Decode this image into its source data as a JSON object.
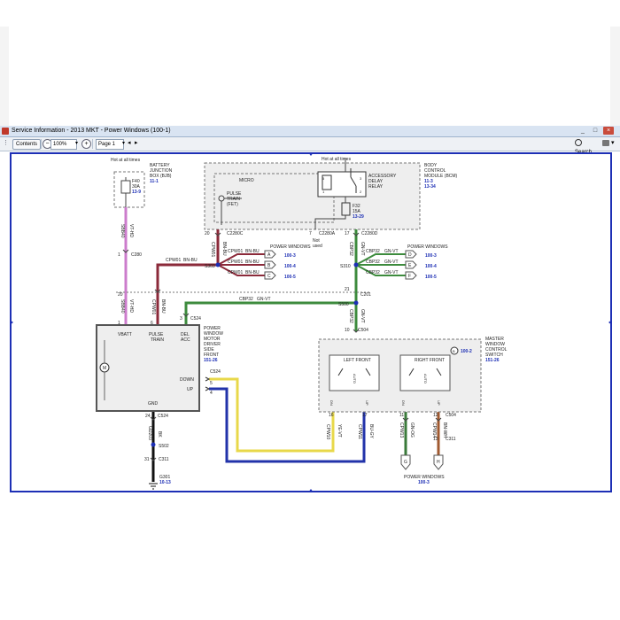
{
  "window": {
    "title": "Service Information - 2013 MKT - Power Windows (100-1)",
    "minimize": "_",
    "maximize": "□",
    "close": "×"
  },
  "toolbar": {
    "contents_label": "Contents",
    "zoom_value": "100%",
    "page_value": "Page 1",
    "search_label": "Search",
    "page_of": "▾"
  },
  "diagram": {
    "hot_at_all_times_left": "Hot at all times",
    "hot_at_all_times_right": "Hot at all times",
    "bjb_title": [
      "BATTERY",
      "JUNCTION",
      "BOX (BJB)"
    ],
    "bjb_ref": "11-1",
    "fuse_left": [
      "F40",
      "30A",
      "13-9"
    ],
    "bcm_title": [
      "BODY",
      "CONTROL",
      "MODULE (BCM)"
    ],
    "bcm_ref": [
      "11-3",
      "13-34"
    ],
    "micro": "MICRO",
    "pulse_train_fet": [
      "PULSE",
      "TRAIN",
      "(FET)"
    ],
    "acc_delay_relay": [
      "ACCESSORY",
      "DELAY",
      "RELAY"
    ],
    "fuse_right": [
      "F32",
      "15A",
      "13-29"
    ],
    "not_used": [
      "Not",
      "used"
    ],
    "connectors": {
      "c2280c": "C2280C",
      "c2280a": "C2280A",
      "c2280d": "C2280D",
      "c280": "C280",
      "s303": "S303",
      "s310": "S310",
      "c201": "C201",
      "s500": "S500",
      "c524a": "C524",
      "c504a": "C504",
      "c524b": "C524",
      "c524c": "C524",
      "s502": "S502",
      "c311a": "C311",
      "g301": "G301",
      "g301_ref": "10-13",
      "c504b": "C504",
      "c311b": "C311"
    },
    "pins": {
      "p20a": "20",
      "p7": "7",
      "p17": "17",
      "p1": "1",
      "p20b": "20",
      "p21": "21",
      "p3": "3",
      "p6": "6",
      "p10": "10",
      "p5": "5",
      "p4": "4",
      "p24": "24",
      "p31": "31",
      "p16": "16",
      "p17b": "17",
      "p11": "11",
      "p12": "12",
      "p13": "13",
      "p5b": "5",
      "p1b": "1",
      "p2": "2",
      "p3b": "3",
      "p4b": "4"
    },
    "wires": {
      "sbb40": "SBB40",
      "vthd": "VT-HD",
      "cpw01_v": "CPW01",
      "bnbu_v": "BN-BU",
      "cpw01_h": "CPW01",
      "bnbu_h": "BN-BU",
      "cpw01_a": "CPW01",
      "bnbu_a": "BN-BU",
      "cpw01_b": "CPW01",
      "bnbu_b": "BN-BU",
      "cpw01_c": "CPW01",
      "bnbu_c": "BN-BU",
      "cbp32_v": "CBP32",
      "gnvt_v": "GN-VT",
      "cbp32_d": "CBP32",
      "gnvt_d": "GN-VT",
      "cbp32_e": "CBP32",
      "gnvt_e": "GN-VT",
      "cbp32_f": "CBP32",
      "gnvt_f": "GN-VT",
      "cbp32_h": "CBP32",
      "gnvt_h": "GN-VT",
      "cbp32_v2": "CBP32",
      "gnvt_v2": "GN-VT",
      "sbb40b": "SBB40",
      "vthd_b": "VT-HD",
      "cpw01_d": "CPW01",
      "bnbu_d": "BN-BU",
      "gd203": "GD203",
      "bk": "BK",
      "cpw10": "CPW10",
      "yevt": "YE-VT",
      "cpw11": "CPW11",
      "bugy": "BU-GY",
      "cpw13": "CPW13",
      "gnog": "GN-OG",
      "cpw14": "CPW14",
      "bnwh": "BN-WH"
    },
    "power_windows_top": "POWER WINDOWS",
    "power_windows_right": "POWER WINDOWS",
    "power_windows_bottom": "POWER WINDOWS",
    "pw_bottom_ref": "100-3",
    "refs_top": [
      "100-3",
      "100-4",
      "100-5"
    ],
    "refs_right": [
      "100-3",
      "100-4",
      "100-5"
    ],
    "letters_top": [
      "A",
      "B",
      "C"
    ],
    "letters_right": [
      "D",
      "E",
      "F"
    ],
    "letters_bottom": [
      "G",
      "H"
    ],
    "motor_title": [
      "POWER",
      "WINDOW",
      "MOTOR",
      "DRIVER",
      "SIDE",
      "FRONT"
    ],
    "motor_ref": "151-26",
    "motor_vbatt": "VBATT",
    "motor_pulse": [
      "PULSE",
      "TRAIN"
    ],
    "motor_del_acc": [
      "DEL",
      "ACC"
    ],
    "motor_down": "DOWN",
    "motor_up": "UP",
    "motor_gnd": "GND",
    "motor_m": "M",
    "master_title": [
      "MASTER",
      "WINDOW",
      "CONTROL",
      "SWITCH"
    ],
    "master_ref": "151-26",
    "master_b_ref": "100-2",
    "master_b": "B",
    "left_front": "LEFT FRONT",
    "right_front": "RIGHT FRONT",
    "auto": "AUTO",
    "dn": "DN",
    "up": "UP",
    "relay_pins": [
      "5",
      "1",
      "2",
      "3"
    ]
  }
}
